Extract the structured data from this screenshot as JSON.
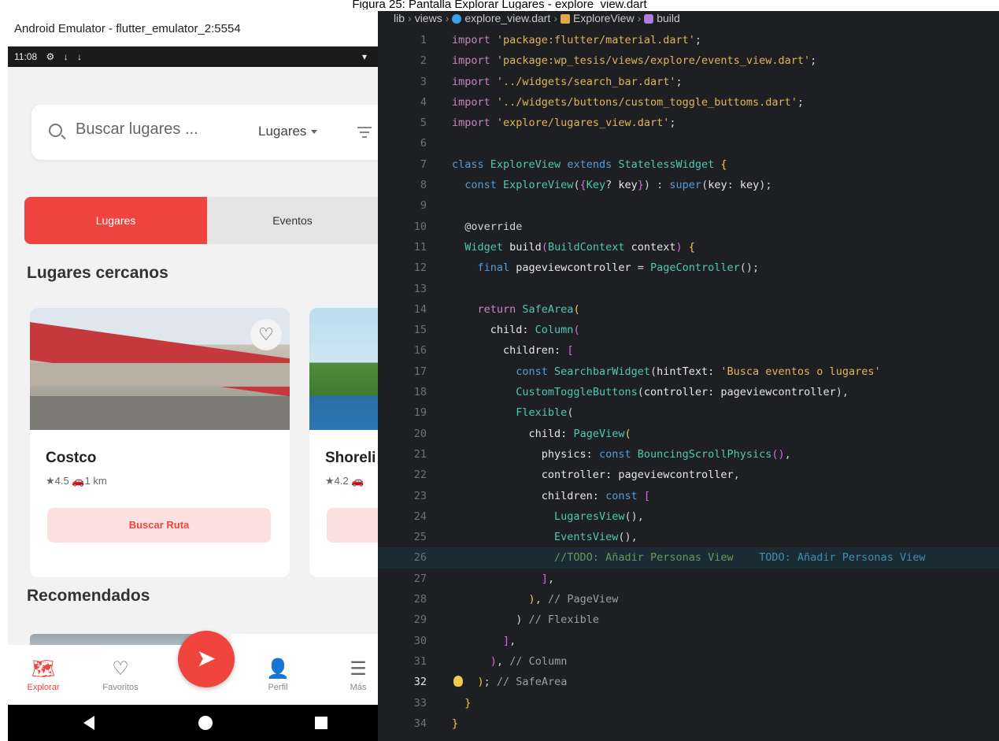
{
  "caption": "Figura 25: Pantalla Explorar Lugares - explore_view.dart",
  "emulator": {
    "title": "Android Emulator - flutter_emulator_2:5554",
    "status": {
      "time": "11:08",
      "icons": [
        "⚙",
        "↓",
        "↓"
      ],
      "right": "▾"
    }
  },
  "app": {
    "search": {
      "placeholder": "Buscar lugares ...",
      "filter_label": "Lugares"
    },
    "toggle": {
      "on": "Lugares",
      "off": "Eventos"
    },
    "nearby_title": "Lugares cercanos",
    "cards": [
      {
        "name": "Costco",
        "meta": "★4.5 🚗1 km",
        "button": "Buscar Ruta"
      },
      {
        "name": "Shoreli",
        "meta": "★4.2 🚗"
      }
    ],
    "recommended_title": "Recomendados",
    "nav": [
      {
        "label": "Explorar",
        "icon": "map-icon",
        "glyph": "🗺"
      },
      {
        "label": "Favoritos",
        "icon": "heart-icon",
        "glyph": "♡"
      },
      {
        "label": "Perfil",
        "icon": "person-icon",
        "glyph": "👤"
      },
      {
        "label": "Más",
        "icon": "menu-icon",
        "glyph": "☰"
      }
    ],
    "colors": {
      "accent": "#f0443e",
      "accent_light": "#fbe0df"
    }
  },
  "editor": {
    "breadcrumb": [
      "lib",
      "views",
      "explore_view.dart",
      "ExploreView",
      "build"
    ],
    "current_line": 32,
    "highlight_line": 26,
    "lines": [
      [
        [
          "import ",
          "#c586c0"
        ],
        [
          "'package:flutter/material.dart'",
          "#e0b65a"
        ],
        [
          ";",
          "#d4d4d4"
        ]
      ],
      [
        [
          "import ",
          "#c586c0"
        ],
        [
          "'package:wp_tesis/views/explore/events_view.dart'",
          "#e0b65a"
        ],
        [
          ";",
          "#d4d4d4"
        ]
      ],
      [
        [
          "import ",
          "#c586c0"
        ],
        [
          "'../widgets/search_bar.dart'",
          "#e0b65a"
        ],
        [
          ";",
          "#d4d4d4"
        ]
      ],
      [
        [
          "import ",
          "#c586c0"
        ],
        [
          "'../widgets/buttons/custom_toggle_buttoms.dart'",
          "#e0b65a"
        ],
        [
          ";",
          "#d4d4d4"
        ]
      ],
      [
        [
          "import ",
          "#c586c0"
        ],
        [
          "'explore/lugares_view.dart'",
          "#e0b65a"
        ],
        [
          ";",
          "#d4d4d4"
        ]
      ],
      [],
      [
        [
          "class ",
          "#569cd6"
        ],
        [
          "ExploreView ",
          "#4ec9b0"
        ],
        [
          "extends ",
          "#569cd6"
        ],
        [
          "StatelessWidget ",
          "#4ec9b0"
        ],
        [
          "{",
          "#f2c94c"
        ]
      ],
      [
        [
          "  const ",
          "#569cd6"
        ],
        [
          "ExploreView",
          "#4ec9b0"
        ],
        [
          "(",
          "#d4d4d4"
        ],
        [
          "{",
          "#d36be0"
        ],
        [
          "Key",
          "#4ec9b0"
        ],
        [
          "? ",
          "#d4d4d4"
        ],
        [
          "key",
          "#e8e8e8"
        ],
        [
          "}",
          "#d36be0"
        ],
        [
          ") : ",
          "#d4d4d4"
        ],
        [
          "super",
          "#569cd6"
        ],
        [
          "(",
          "#d4d4d4"
        ],
        [
          "key",
          "#e8e8e8"
        ],
        [
          ": ",
          "#d4d4d4"
        ],
        [
          "key",
          "#e8e8e8"
        ],
        [
          ");",
          "#d4d4d4"
        ]
      ],
      [],
      [
        [
          "  @override",
          "#d4d4d4"
        ]
      ],
      [
        [
          "  ",
          "#d4d4d4"
        ],
        [
          "Widget ",
          "#4ec9b0"
        ],
        [
          "build",
          "#e8e8e8"
        ],
        [
          "(",
          "#d36be0"
        ],
        [
          "BuildContext ",
          "#4ec9b0"
        ],
        [
          "context",
          "#e8e8e8"
        ],
        [
          ") ",
          "#d36be0"
        ],
        [
          "{",
          "#f2c94c"
        ]
      ],
      [
        [
          "    final ",
          "#569cd6"
        ],
        [
          "pageviewcontroller ",
          "#e8e8e8"
        ],
        [
          "= ",
          "#d4d4d4"
        ],
        [
          "PageController",
          "#4ec9b0"
        ],
        [
          "();",
          "#d4d4d4"
        ]
      ],
      [],
      [
        [
          "    return ",
          "#c586c0"
        ],
        [
          "SafeArea",
          "#4ec9b0"
        ],
        [
          "(",
          "#f2c94c"
        ]
      ],
      [
        [
          "      child: ",
          "#e8e8e8"
        ],
        [
          "Column",
          "#4ec9b0"
        ],
        [
          "(",
          "#d36be0"
        ]
      ],
      [
        [
          "        children: ",
          "#e8e8e8"
        ],
        [
          "[",
          "#d36be0"
        ]
      ],
      [
        [
          "          const ",
          "#569cd6"
        ],
        [
          "SearchbarWidget",
          "#4ec9b0"
        ],
        [
          "(",
          "#d4d4d4"
        ],
        [
          "hintText: ",
          "#e8e8e8"
        ],
        [
          "'Busca eventos o lugares'",
          "#e0b65a"
        ]
      ],
      [
        [
          "          ",
          "#d4d4d4"
        ],
        [
          "CustomToggleButtons",
          "#4ec9b0"
        ],
        [
          "(",
          "#d4d4d4"
        ],
        [
          "controller: ",
          "#e8e8e8"
        ],
        [
          "pageviewcontroller",
          "#e8e8e8"
        ],
        [
          "),",
          "#d4d4d4"
        ]
      ],
      [
        [
          "          ",
          "#d4d4d4"
        ],
        [
          "Flexible",
          "#4ec9b0"
        ],
        [
          "(",
          "#d4d4d4"
        ]
      ],
      [
        [
          "            child: ",
          "#e8e8e8"
        ],
        [
          "PageView",
          "#4ec9b0"
        ],
        [
          "(",
          "#f2c94c"
        ]
      ],
      [
        [
          "              physics: ",
          "#e8e8e8"
        ],
        [
          "const ",
          "#569cd6"
        ],
        [
          "BouncingScrollPhysics",
          "#4ec9b0"
        ],
        [
          "()",
          "#d36be0"
        ],
        [
          ",",
          "#d4d4d4"
        ]
      ],
      [
        [
          "              controller: ",
          "#e8e8e8"
        ],
        [
          "pageviewcontroller",
          "#e8e8e8"
        ],
        [
          ",",
          "#d4d4d4"
        ]
      ],
      [
        [
          "              children: ",
          "#e8e8e8"
        ],
        [
          "const ",
          "#569cd6"
        ],
        [
          "[",
          "#d36be0"
        ]
      ],
      [
        [
          "                ",
          "#d4d4d4"
        ],
        [
          "LugaresView",
          "#4ec9b0"
        ],
        [
          "(),",
          "#d4d4d4"
        ]
      ],
      [
        [
          "                ",
          "#d4d4d4"
        ],
        [
          "EventsView",
          "#4ec9b0"
        ],
        [
          "(),",
          "#d4d4d4"
        ]
      ],
      [
        [
          "                //TODO: Añadir Personas View",
          "#6a9955"
        ],
        [
          "    TODO: Añadir Personas View",
          "#3e8fb0"
        ]
      ],
      [
        [
          "              ",
          "#d4d4d4"
        ],
        [
          "]",
          "#d36be0"
        ],
        [
          ",",
          "#d4d4d4"
        ]
      ],
      [
        [
          "            ",
          "#d4d4d4"
        ],
        [
          ")",
          "#f2c94c"
        ],
        [
          ", ",
          "#d4d4d4"
        ],
        [
          "// PageView",
          "#9aa0a6"
        ]
      ],
      [
        [
          "          ) ",
          "#d4d4d4"
        ],
        [
          "// Flexible",
          "#9aa0a6"
        ]
      ],
      [
        [
          "        ",
          "#d4d4d4"
        ],
        [
          "]",
          "#d36be0"
        ],
        [
          ",",
          "#d4d4d4"
        ]
      ],
      [
        [
          "      ",
          "#d4d4d4"
        ],
        [
          ")",
          "#d36be0"
        ],
        [
          ", ",
          "#d4d4d4"
        ],
        [
          "// Column",
          "#9aa0a6"
        ]
      ],
      [
        [
          "    ",
          "#d4d4d4"
        ],
        [
          ")",
          "#f2c94c"
        ],
        [
          "; ",
          "#d4d4d4"
        ],
        [
          "// SafeArea",
          "#9aa0a6"
        ]
      ],
      [
        [
          "  ",
          "#d4d4d4"
        ],
        [
          "}",
          "#f2c94c"
        ]
      ],
      [
        [
          "}",
          "#f2c94c"
        ]
      ]
    ]
  }
}
